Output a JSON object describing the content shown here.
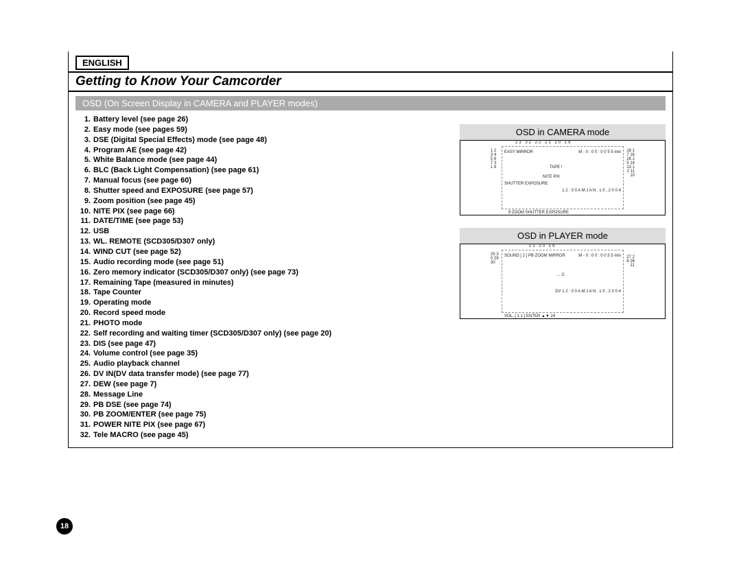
{
  "language": "ENGLISH",
  "title": "Getting to Know Your Camcorder",
  "sub_header": "OSD (On Screen Display in CAMERA and PLAYER modes)",
  "page_number": "18",
  "panels": {
    "camera": "OSD in CAMERA mode",
    "player": "OSD in PLAYER mode"
  },
  "items": [
    {
      "n": "1.",
      "t": "Battery level (see page 26)"
    },
    {
      "n": "2.",
      "t": "Easy mode (see pages 59)"
    },
    {
      "n": "3.",
      "t": "DSE (Digital Special Effects) mode (see page 48)"
    },
    {
      "n": "4.",
      "t": "Program AE (see page 42)"
    },
    {
      "n": "5.",
      "t": "White Balance mode (see page 44)"
    },
    {
      "n": "6.",
      "t": "BLC (Back Light Compensation) (see page 61)"
    },
    {
      "n": "7.",
      "t": "Manual focus (see page 60)"
    },
    {
      "n": "8.",
      "t": "Shutter speed and EXPOSURE (see page 57)"
    },
    {
      "n": "9.",
      "t": "Zoom position (see page 45)"
    },
    {
      "n": "10.",
      "t": "NITE PIX (see page 66)"
    },
    {
      "n": "11.",
      "t": "DATE/TIME (see page 53)"
    },
    {
      "n": "12.",
      "t": "USB"
    },
    {
      "n": "13.",
      "t": "WL. REMOTE (SCD305/D307 only)"
    },
    {
      "n": "14.",
      "t": "WIND CUT (see page 52)"
    },
    {
      "n": "15.",
      "t": "Audio recording mode (see page 51)"
    },
    {
      "n": "16.",
      "t": "Zero memory indicator (SCD305/D307 only) (see page 73)"
    },
    {
      "n": "17.",
      "t": "Remaining Tape (measured in minutes)"
    },
    {
      "n": "18.",
      "t": "Tape Counter"
    },
    {
      "n": "19.",
      "t": "Operating mode"
    },
    {
      "n": "20.",
      "t": "Record speed mode"
    },
    {
      "n": "21.",
      "t": "PHOTO mode"
    },
    {
      "n": "22.",
      "t": "Self recording and waiting timer (SCD305/D307 only) (see page 20)"
    },
    {
      "n": "23.",
      "t": "DIS (see page 47)"
    },
    {
      "n": "24.",
      "t": "Volume control (see page 35)"
    },
    {
      "n": "25.",
      "t": "Audio playback channel"
    },
    {
      "n": "26.",
      "t": "DV IN(DV data transfer mode) (see page 77)"
    },
    {
      "n": "27.",
      "t": "DEW (see page 7)"
    },
    {
      "n": "28.",
      "t": "Message Line"
    },
    {
      "n": "29.",
      "t": "PB DSE (see page 74)"
    },
    {
      "n": "30.",
      "t": "PB ZOOM/ENTER (see page 75)"
    },
    {
      "n": "31.",
      "t": "POWER NITE PIX (see page 67)"
    },
    {
      "n": "32.",
      "t": "Tele MACRO (see page 45)"
    }
  ],
  "camera_labels": {
    "top": "23 32 22 21    20 19",
    "left": "1 2 3 4 5 6 7   31   8",
    "right": "18 17 16 28 15 14 13 12   11   10",
    "inside_tl": "EASY MIRROR",
    "inside_tr": "M - 0 : 0 0 : 0 0   5 5 min",
    "inside_mid": "TAPE !",
    "inside_center": "NITE PIX",
    "inside_bl": "SHUTTER EXPOSURE",
    "inside_br": "1 2 : 0 0 A M   J A N . 1 0 , 2 0 0 4",
    "bottom": "9   ZOOM   SHUTTER   EXPOSURE"
  },
  "player_labels": {
    "top": "21 20    19",
    "left": "25 30 29    30",
    "right": "27   28   26    11",
    "inside_tl": "SOUND [ 2 ]   PB ZOOM   MIRROR",
    "inside_tr": "M - 0 : 0 0 : 0 0   5 5 min",
    "inside_mid": "… C",
    "inside_br": "DV   1 2 : 0 0 A M   J A N . 1 0 , 2 0 0 4",
    "bottom": "VOL.  [ 1 1 ]   ENTER  ▲▼   24"
  }
}
